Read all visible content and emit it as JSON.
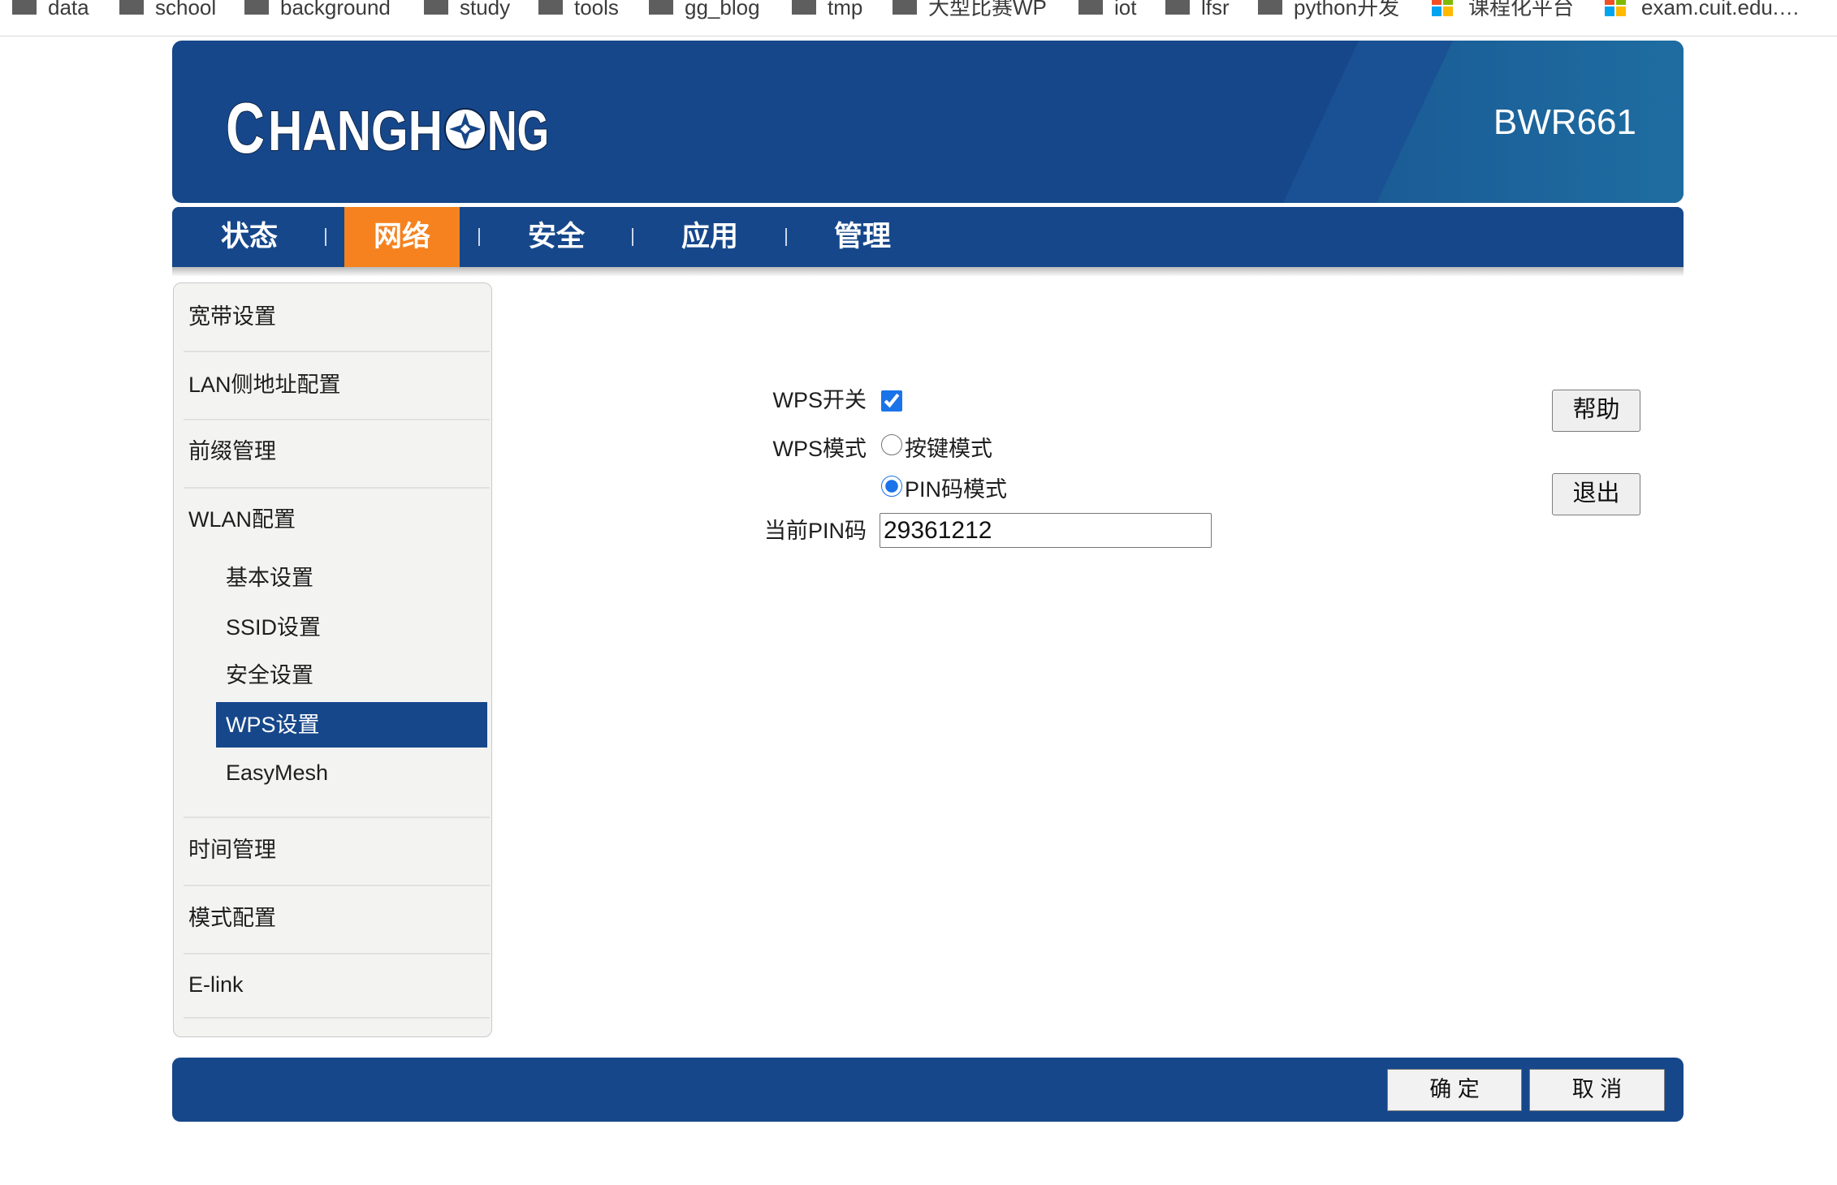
{
  "bookmarks": [
    {
      "label": "data",
      "icon": "folder-icon"
    },
    {
      "label": "school",
      "icon": "folder-icon"
    },
    {
      "label": "background",
      "icon": "folder-icon"
    },
    {
      "label": "study",
      "icon": "folder-icon"
    },
    {
      "label": "tools",
      "icon": "folder-icon"
    },
    {
      "label": "gg_blog",
      "icon": "folder-icon"
    },
    {
      "label": "tmp",
      "icon": "folder-icon"
    },
    {
      "label": "大型比赛WP",
      "icon": "folder-icon"
    },
    {
      "label": "iot",
      "icon": "folder-icon"
    },
    {
      "label": "lfsr",
      "icon": "folder-icon"
    },
    {
      "label": "python开发",
      "icon": "folder-icon"
    },
    {
      "label": "课程化平台",
      "icon": "site-favicon-icon"
    },
    {
      "label": "exam.cuit.edu.…",
      "icon": "site-favicon-icon"
    }
  ],
  "header": {
    "logo_text": "CHANGHONG",
    "model": "BWR661"
  },
  "nav": {
    "items": [
      {
        "label": "状态"
      },
      {
        "label": "网络",
        "active": true
      },
      {
        "label": "安全"
      },
      {
        "label": "应用"
      },
      {
        "label": "管理"
      }
    ]
  },
  "sidebar": {
    "items": [
      {
        "label": "宽带设置"
      },
      {
        "label": "LAN侧地址配置"
      },
      {
        "label": "前缀管理"
      },
      {
        "label": "WLAN配置",
        "children": [
          {
            "label": "基本设置"
          },
          {
            "label": "SSID设置"
          },
          {
            "label": "安全设置"
          },
          {
            "label": "WPS设置",
            "selected": true
          },
          {
            "label": "EasyMesh"
          }
        ]
      },
      {
        "label": "时间管理"
      },
      {
        "label": "模式配置"
      },
      {
        "label": "E-link"
      }
    ]
  },
  "form": {
    "wps_switch": {
      "label": "WPS开关",
      "checked": true
    },
    "wps_mode": {
      "label": "WPS模式",
      "options": [
        {
          "label": "按键模式",
          "selected": false
        },
        {
          "label": "PIN码模式",
          "selected": true
        }
      ]
    },
    "current_pin": {
      "label": "当前PIN码",
      "value": "29361212"
    }
  },
  "side_buttons": {
    "help": "帮助",
    "exit": "退出"
  },
  "footer": {
    "confirm": "确 定",
    "cancel": "取 消"
  },
  "theme": {
    "primary": "#16478a",
    "accent": "#f5821f",
    "sidebar_bg": "#f3f4f2",
    "control_blue": "#1a73e8"
  }
}
